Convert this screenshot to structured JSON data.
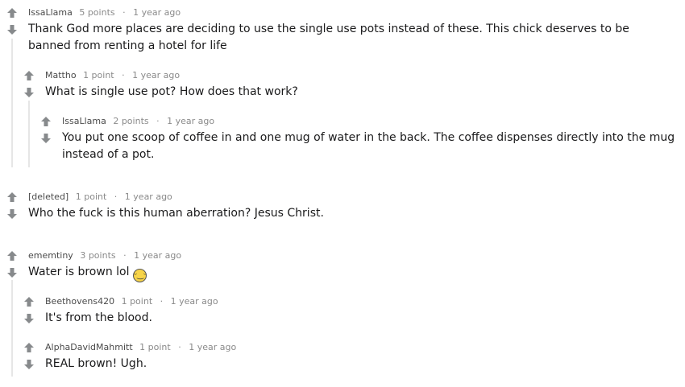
{
  "comments": [
    {
      "author": "IssaLlama",
      "points": "5 points",
      "time": "1 year ago",
      "text": "Thank God more places are deciding to use the single use pots instead of these. This chick deserves to be banned from renting a hotel for life"
    },
    {
      "author": "Mattho",
      "points": "1 point",
      "time": "1 year ago",
      "text": "What is single use pot? How does that work?"
    },
    {
      "author": "IssaLlama",
      "points": "2 points",
      "time": "1 year ago",
      "text": "You put one scoop of coffee in and one mug of water in the back. The coffee dispenses directly into the mug instead of a pot."
    },
    {
      "author": "[deleted]",
      "points": "1 point",
      "time": "1 year ago",
      "text": "Who the fuck is this human aberration? Jesus Christ."
    },
    {
      "author": "ememtiny",
      "points": "3 points",
      "time": "1 year ago",
      "text": "Water is brown lol",
      "emoji": "laughing-face"
    },
    {
      "author": "Beethovens420",
      "points": "1 point",
      "time": "1 year ago",
      "text": "It's from the blood."
    },
    {
      "author": "AlphaDavidMahmitt",
      "points": "1 point",
      "time": "1 year ago",
      "text": "REAL brown! Ugh."
    }
  ],
  "separator": "·",
  "colors": {
    "arrow": "#878a8c",
    "thread_line": "#e6e6e6",
    "meta": "#8a8a8a"
  }
}
